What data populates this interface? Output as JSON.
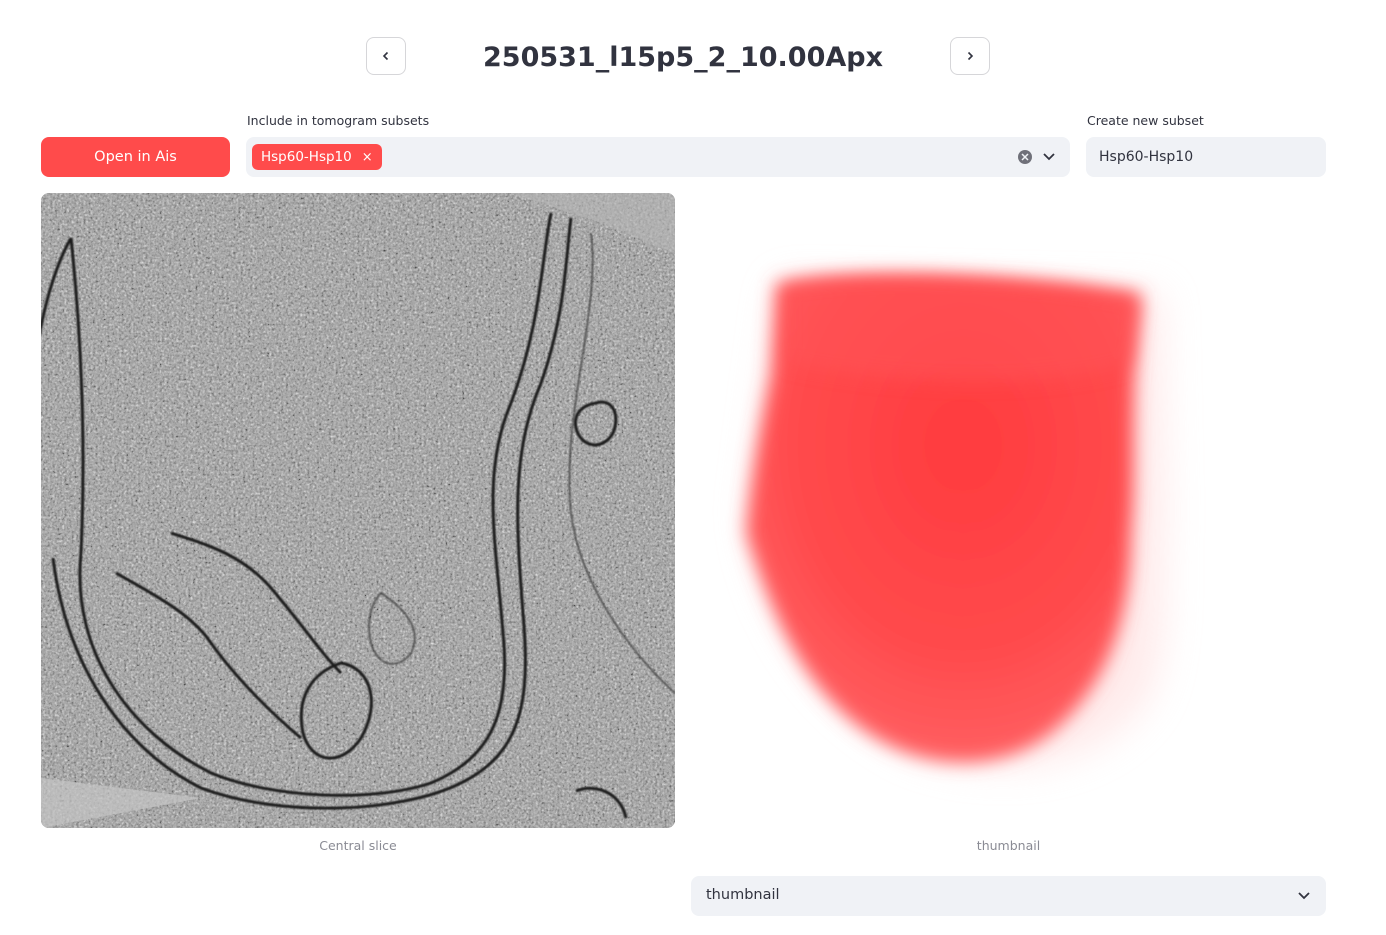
{
  "header": {
    "title": "250531_l15p5_2_10.00Apx",
    "prev_icon": "chevron-left-icon",
    "next_icon": "chevron-right-icon"
  },
  "actions": {
    "open_label": "Open in Ais"
  },
  "subsets": {
    "label": "Include in tomogram subsets",
    "selected": [
      "Hsp60-Hsp10"
    ],
    "close_glyph": "×"
  },
  "new_subset": {
    "label": "Create new subset",
    "value": "Hsp60-Hsp10"
  },
  "images": {
    "left_caption": "Central slice",
    "right_caption": "thumbnail"
  },
  "view_select": {
    "value": "thumbnail"
  },
  "colors": {
    "accent": "#ff4b4b",
    "input_bg": "#f0f2f6",
    "text": "#31333f",
    "caption": "#8a8b94"
  }
}
